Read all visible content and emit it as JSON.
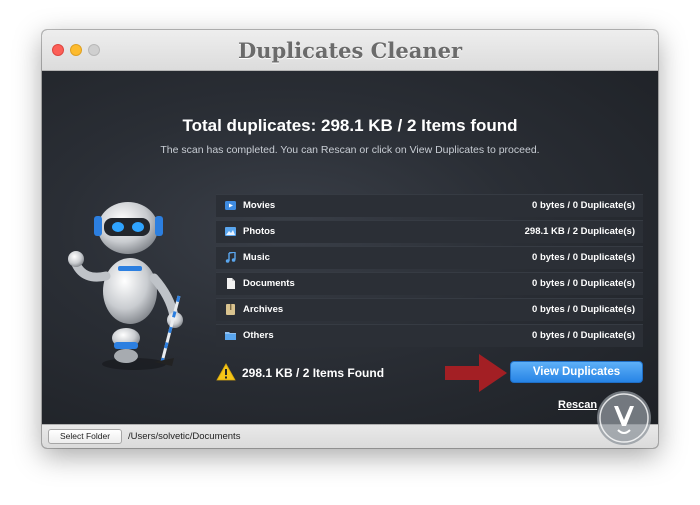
{
  "window": {
    "title": "Duplicates Cleaner"
  },
  "main": {
    "headline": "Total duplicates: 298.1 KB / 2 Items found",
    "subline": "The scan has completed.  You can Rescan or click on View Duplicates to proceed.",
    "categories": [
      {
        "label": "Movies",
        "value": "0 bytes / 0 Duplicate(s)",
        "icon": "movie-icon"
      },
      {
        "label": "Photos",
        "value": "298.1 KB / 2 Duplicate(s)",
        "icon": "photo-icon"
      },
      {
        "label": "Music",
        "value": "0 bytes / 0 Duplicate(s)",
        "icon": "music-icon"
      },
      {
        "label": "Documents",
        "value": "0 bytes / 0 Duplicate(s)",
        "icon": "document-icon"
      },
      {
        "label": "Archives",
        "value": "0 bytes / 0 Duplicate(s)",
        "icon": "archive-icon"
      },
      {
        "label": "Others",
        "value": "0 bytes / 0 Duplicate(s)",
        "icon": "others-icon"
      }
    ],
    "summary": "298.1 KB / 2 Items Found",
    "view_button": "View Duplicates",
    "rescan_link": "Rescan"
  },
  "footer": {
    "select_folder_label": "Select Folder",
    "path": "/Users/solvetic/Documents"
  },
  "colors": {
    "accent_blue": "#2784e6",
    "arrow_red": "#a31f24",
    "warning_yellow": "#f5c518"
  }
}
